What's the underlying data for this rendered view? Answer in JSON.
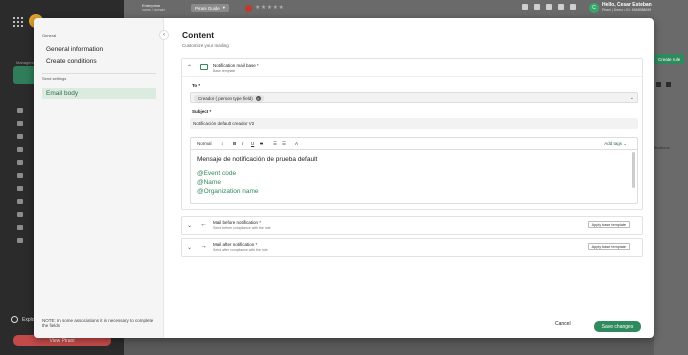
{
  "app": {
    "topbar": {
      "org_name": "Enterprise",
      "org_sub": "name / domain",
      "guide_label": "Pirani Guide",
      "user_name": "Hello, Cesar Esteban",
      "user_sub": "Pirani | Demo • ID: 8968988699",
      "avatar_initial": "C"
    },
    "sidebar": {
      "top_label": "Management",
      "explore_label": "Explore",
      "view_button": "View Pirani"
    },
    "right": {
      "action_label": "Create rule",
      "notif_text": "ifications"
    }
  },
  "modal": {
    "nav": {
      "section_general": "General",
      "item_general_info": "General information",
      "item_create_conditions": "Create conditions",
      "section_send": "Send settings",
      "item_email_body": "Email body",
      "note": "NOTE: In some associations it is necessary to complete the fields"
    },
    "content": {
      "title": "Content",
      "subtitle": "Customize your mailing"
    },
    "notif_card": {
      "title": "Notification mail base *",
      "subtitle": "Base template",
      "to_label": "To *",
      "to_chip": "Creador ( person type field)",
      "subject_label": "Subject *",
      "subject_value": "Notificación default creador V2",
      "toolbar": {
        "style": "Normal",
        "size": "↕",
        "bold": "B",
        "italic": "I",
        "underline": "U",
        "strike": "S",
        "list_ordered": "☰",
        "list_bullet": "☰",
        "color": "A",
        "add_tags": "Add tags"
      },
      "body_line": "Mensaje de notificación de prueba default",
      "vars": [
        "@Event code",
        "@Name",
        "@Organization name"
      ]
    },
    "before_row": {
      "title": "Mail before notification *",
      "subtitle": "Send before compliance with the rule",
      "button": "Apply base template"
    },
    "after_row": {
      "title": "Mail after notification *",
      "subtitle": "Send after compliance with the rule",
      "button": "Apply base template"
    },
    "footer": {
      "cancel": "Cancel",
      "save": "Save changes"
    }
  },
  "colors": {
    "accent": "#2f8a5e",
    "danger": "#c44a4a",
    "nav_active_bg": "#dcebe0"
  }
}
